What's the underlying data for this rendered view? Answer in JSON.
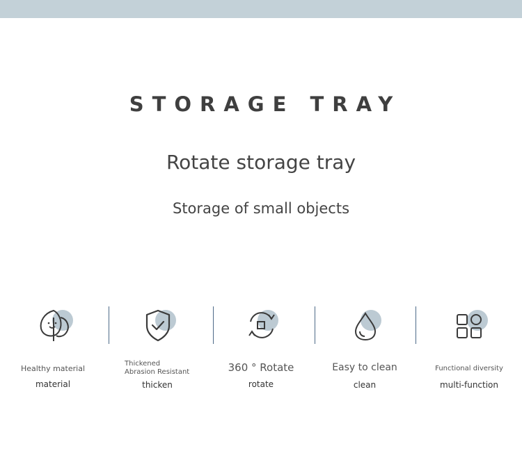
{
  "colors": {
    "banner": "#c3d1d8",
    "accent_circle": "#bccad3",
    "divider": "#4d6a88"
  },
  "title": "STORAGE TRAY",
  "subtitle": "Rotate storage tray",
  "description": "Storage of small objects",
  "features": [
    {
      "icon": "leaf-icon",
      "label": "Healthy material",
      "sub": "material"
    },
    {
      "icon": "shield-check-icon",
      "label_line1": "Thickened",
      "label_line2": "Abrasion Resistant",
      "sub": "thicken"
    },
    {
      "icon": "rotate-icon",
      "label": "360 ° Rotate",
      "sub": "rotate"
    },
    {
      "icon": "water-drop-icon",
      "label": "Easy to clean",
      "sub": "clean"
    },
    {
      "icon": "grid-apps-icon",
      "label": "Functional diversity",
      "sub": "multi-function"
    }
  ]
}
